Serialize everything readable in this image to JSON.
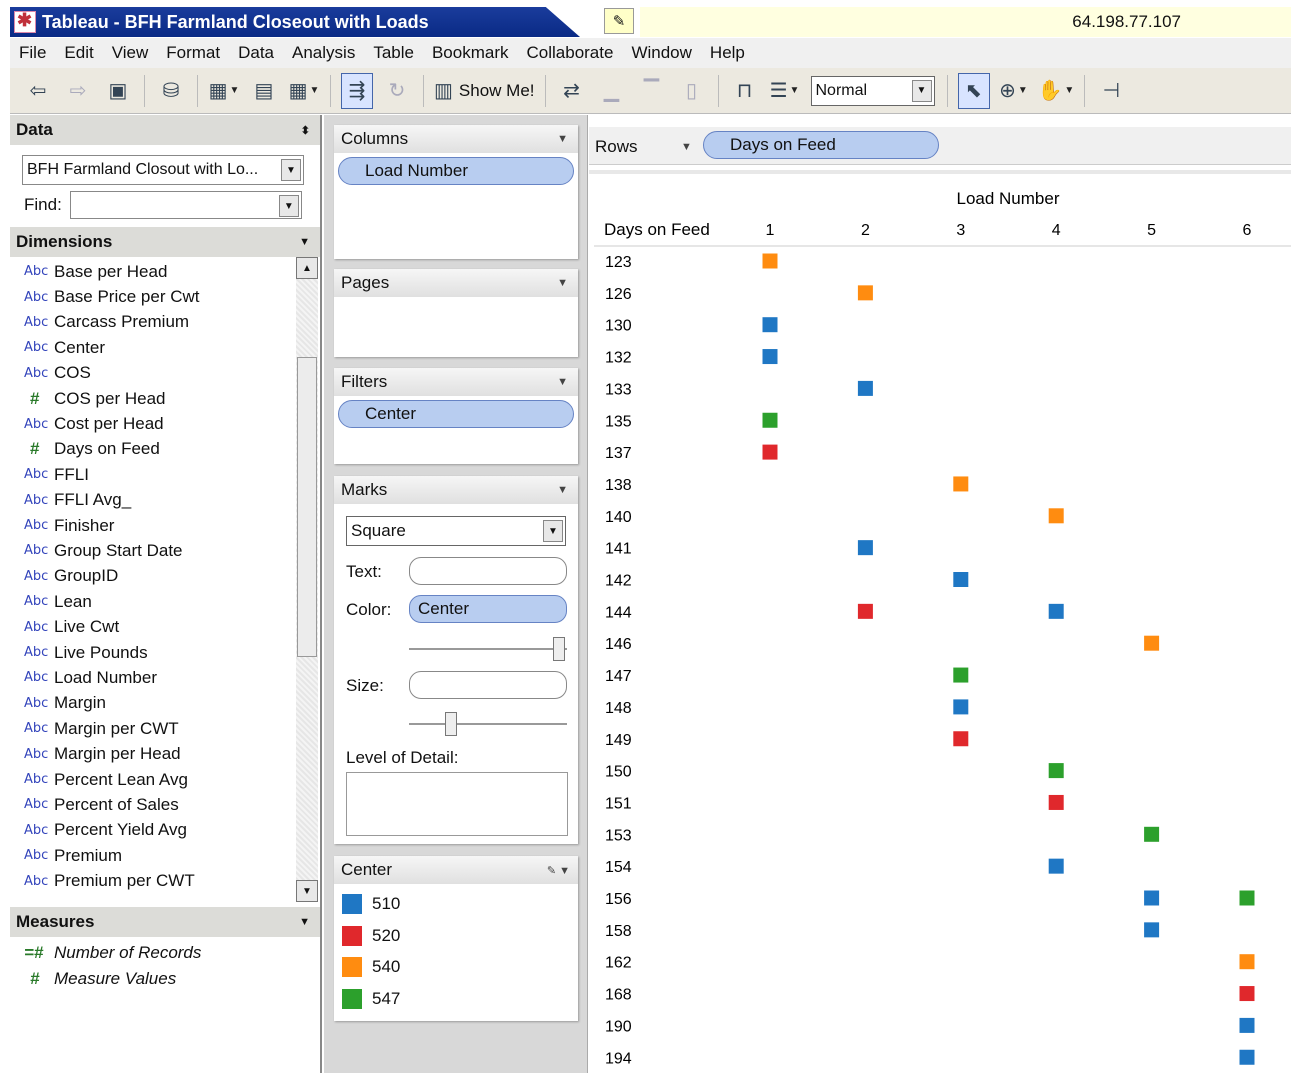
{
  "window": {
    "title": "Tableau - BFH Farmland Closeout with Loads",
    "ip": "64.198.77.107"
  },
  "menu": [
    "File",
    "Edit",
    "View",
    "Format",
    "Data",
    "Analysis",
    "Table",
    "Bookmark",
    "Collaborate",
    "Window",
    "Help"
  ],
  "toolbar": {
    "show_me": "Show Me!",
    "fit_value": "Normal"
  },
  "data_panel": {
    "header": "Data",
    "datasource": "BFH Farmland Closout with Lo...",
    "find_label": "Find:",
    "find_value": "",
    "dimensions_header": "Dimensions",
    "dimensions": [
      {
        "type": "abc",
        "name": "Base per Head"
      },
      {
        "type": "abc",
        "name": "Base Price per Cwt"
      },
      {
        "type": "abc",
        "name": "Carcass Premium"
      },
      {
        "type": "abc",
        "name": "Center"
      },
      {
        "type": "abc",
        "name": "COS"
      },
      {
        "type": "num",
        "name": "COS per Head"
      },
      {
        "type": "abc",
        "name": "Cost per Head"
      },
      {
        "type": "num",
        "name": "Days on Feed"
      },
      {
        "type": "abc",
        "name": "FFLI"
      },
      {
        "type": "abc",
        "name": "FFLI Avg_"
      },
      {
        "type": "abc",
        "name": "Finisher"
      },
      {
        "type": "abc",
        "name": "Group Start Date"
      },
      {
        "type": "abc",
        "name": "GroupID"
      },
      {
        "type": "abc",
        "name": "Lean"
      },
      {
        "type": "abc",
        "name": "Live Cwt"
      },
      {
        "type": "abc",
        "name": "Live Pounds"
      },
      {
        "type": "abc",
        "name": "Load Number"
      },
      {
        "type": "abc",
        "name": "Margin"
      },
      {
        "type": "abc",
        "name": "Margin per CWT"
      },
      {
        "type": "abc",
        "name": "Margin per Head"
      },
      {
        "type": "abc",
        "name": "Percent Lean Avg"
      },
      {
        "type": "abc",
        "name": "Percent of Sales"
      },
      {
        "type": "abc",
        "name": "Percent Yield Avg"
      },
      {
        "type": "abc",
        "name": "Premium"
      },
      {
        "type": "abc",
        "name": "Premium per CWT"
      }
    ],
    "measures_header": "Measures",
    "measures": [
      "Number of Records",
      "Measure Values"
    ]
  },
  "shelves": {
    "columns_label": "Columns",
    "columns_pill": "Load Number",
    "pages_label": "Pages",
    "filters_label": "Filters",
    "filters_pill": "Center",
    "marks_label": "Marks",
    "mark_type": "Square",
    "text_label": "Text:",
    "color_label": "Color:",
    "color_field": "Center",
    "size_label": "Size:",
    "lod_label": "Level of Detail:",
    "rows_label": "Rows",
    "rows_pill": "Days on Feed"
  },
  "legend": {
    "title": "Center",
    "items": [
      {
        "label": "510",
        "color": "#1f77c4"
      },
      {
        "label": "520",
        "color": "#e0282c"
      },
      {
        "label": "540",
        "color": "#ff8c10"
      },
      {
        "label": "547",
        "color": "#2ca02c"
      }
    ]
  },
  "chart_data": {
    "type": "scatter",
    "mark": "square",
    "column_header": "Load Number",
    "row_header": "Days on Feed",
    "columns": [
      "1",
      "2",
      "3",
      "4",
      "5",
      "6"
    ],
    "rows": [
      "123",
      "126",
      "130",
      "132",
      "133",
      "135",
      "137",
      "138",
      "140",
      "141",
      "142",
      "144",
      "146",
      "147",
      "148",
      "149",
      "150",
      "151",
      "153",
      "154",
      "156",
      "158",
      "162",
      "168",
      "190",
      "194"
    ],
    "points": [
      {
        "row": "123",
        "col": "1",
        "center": "540"
      },
      {
        "row": "126",
        "col": "2",
        "center": "540"
      },
      {
        "row": "130",
        "col": "1",
        "center": "510"
      },
      {
        "row": "132",
        "col": "1",
        "center": "510"
      },
      {
        "row": "133",
        "col": "2",
        "center": "510"
      },
      {
        "row": "135",
        "col": "1",
        "center": "547"
      },
      {
        "row": "137",
        "col": "1",
        "center": "520"
      },
      {
        "row": "138",
        "col": "3",
        "center": "540"
      },
      {
        "row": "140",
        "col": "4",
        "center": "540"
      },
      {
        "row": "141",
        "col": "2",
        "center": "510"
      },
      {
        "row": "142",
        "col": "3",
        "center": "510"
      },
      {
        "row": "144",
        "col": "2",
        "center": "520"
      },
      {
        "row": "144",
        "col": "4",
        "center": "510"
      },
      {
        "row": "146",
        "col": "5",
        "center": "540"
      },
      {
        "row": "147",
        "col": "3",
        "center": "547"
      },
      {
        "row": "148",
        "col": "3",
        "center": "510"
      },
      {
        "row": "149",
        "col": "3",
        "center": "520"
      },
      {
        "row": "150",
        "col": "4",
        "center": "547"
      },
      {
        "row": "151",
        "col": "4",
        "center": "520"
      },
      {
        "row": "153",
        "col": "5",
        "center": "547"
      },
      {
        "row": "154",
        "col": "4",
        "center": "510"
      },
      {
        "row": "156",
        "col": "5",
        "center": "510"
      },
      {
        "row": "156",
        "col": "6",
        "center": "547"
      },
      {
        "row": "158",
        "col": "5",
        "center": "510"
      },
      {
        "row": "162",
        "col": "6",
        "center": "540"
      },
      {
        "row": "168",
        "col": "6",
        "center": "520"
      },
      {
        "row": "190",
        "col": "6",
        "center": "510"
      },
      {
        "row": "194",
        "col": "6",
        "center": "510"
      }
    ]
  }
}
